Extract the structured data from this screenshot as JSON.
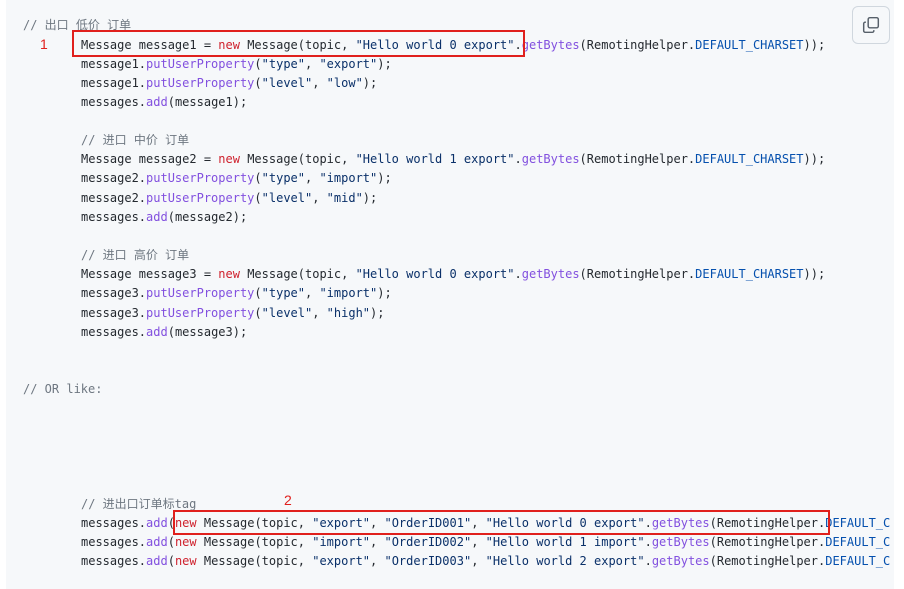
{
  "code_lines": [
    [
      {
        "t": "// 出口 低价 订单",
        "c": "c"
      }
    ],
    [
      {
        "t": "Message message1 = ",
        "c": "p"
      },
      {
        "t": "new",
        "c": "k"
      },
      {
        "t": " Message(topic, ",
        "c": "p"
      },
      {
        "t": "\"Hello world 0 export\"",
        "c": "s"
      },
      {
        "t": ".",
        "c": "p"
      },
      {
        "t": "getBytes",
        "c": "m"
      },
      {
        "t": "(RemotingHelper.",
        "c": "p"
      },
      {
        "t": "DEFAULT_CHARSET",
        "c": "n"
      },
      {
        "t": "));",
        "c": "p"
      }
    ],
    [
      {
        "t": "message1.",
        "c": "p"
      },
      {
        "t": "putUserProperty",
        "c": "m"
      },
      {
        "t": "(",
        "c": "p"
      },
      {
        "t": "\"type\"",
        "c": "s"
      },
      {
        "t": ", ",
        "c": "p"
      },
      {
        "t": "\"export\"",
        "c": "s"
      },
      {
        "t": ");",
        "c": "p"
      }
    ],
    [
      {
        "t": "message1.",
        "c": "p"
      },
      {
        "t": "putUserProperty",
        "c": "m"
      },
      {
        "t": "(",
        "c": "p"
      },
      {
        "t": "\"level\"",
        "c": "s"
      },
      {
        "t": ", ",
        "c": "p"
      },
      {
        "t": "\"low\"",
        "c": "s"
      },
      {
        "t": ");",
        "c": "p"
      }
    ],
    [
      {
        "t": "messages.",
        "c": "p"
      },
      {
        "t": "add",
        "c": "m"
      },
      {
        "t": "(message1);",
        "c": "p"
      }
    ],
    [
      {
        "t": "// 进口 中价 订单",
        "c": "c"
      }
    ],
    [
      {
        "t": "Message message2 = ",
        "c": "p"
      },
      {
        "t": "new",
        "c": "k"
      },
      {
        "t": " Message(topic, ",
        "c": "p"
      },
      {
        "t": "\"Hello world 1 export\"",
        "c": "s"
      },
      {
        "t": ".",
        "c": "p"
      },
      {
        "t": "getBytes",
        "c": "m"
      },
      {
        "t": "(RemotingHelper.",
        "c": "p"
      },
      {
        "t": "DEFAULT_CHARSET",
        "c": "n"
      },
      {
        "t": "));",
        "c": "p"
      }
    ],
    [
      {
        "t": "message2.",
        "c": "p"
      },
      {
        "t": "putUserProperty",
        "c": "m"
      },
      {
        "t": "(",
        "c": "p"
      },
      {
        "t": "\"type\"",
        "c": "s"
      },
      {
        "t": ", ",
        "c": "p"
      },
      {
        "t": "\"import\"",
        "c": "s"
      },
      {
        "t": ");",
        "c": "p"
      }
    ],
    [
      {
        "t": "message2.",
        "c": "p"
      },
      {
        "t": "putUserProperty",
        "c": "m"
      },
      {
        "t": "(",
        "c": "p"
      },
      {
        "t": "\"level\"",
        "c": "s"
      },
      {
        "t": ", ",
        "c": "p"
      },
      {
        "t": "\"mid\"",
        "c": "s"
      },
      {
        "t": ");",
        "c": "p"
      }
    ],
    [
      {
        "t": "messages.",
        "c": "p"
      },
      {
        "t": "add",
        "c": "m"
      },
      {
        "t": "(message2);",
        "c": "p"
      }
    ],
    [
      {
        "t": "// 进口 高价 订单",
        "c": "c"
      }
    ],
    [
      {
        "t": "Message message3 = ",
        "c": "p"
      },
      {
        "t": "new",
        "c": "k"
      },
      {
        "t": " Message(topic, ",
        "c": "p"
      },
      {
        "t": "\"Hello world 0 export\"",
        "c": "s"
      },
      {
        "t": ".",
        "c": "p"
      },
      {
        "t": "getBytes",
        "c": "m"
      },
      {
        "t": "(RemotingHelper.",
        "c": "p"
      },
      {
        "t": "DEFAULT_CHARSET",
        "c": "n"
      },
      {
        "t": "));",
        "c": "p"
      }
    ],
    [
      {
        "t": "message3.",
        "c": "p"
      },
      {
        "t": "putUserProperty",
        "c": "m"
      },
      {
        "t": "(",
        "c": "p"
      },
      {
        "t": "\"type\"",
        "c": "s"
      },
      {
        "t": ", ",
        "c": "p"
      },
      {
        "t": "\"import\"",
        "c": "s"
      },
      {
        "t": ");",
        "c": "p"
      }
    ],
    [
      {
        "t": "message3.",
        "c": "p"
      },
      {
        "t": "putUserProperty",
        "c": "m"
      },
      {
        "t": "(",
        "c": "p"
      },
      {
        "t": "\"level\"",
        "c": "s"
      },
      {
        "t": ", ",
        "c": "p"
      },
      {
        "t": "\"high\"",
        "c": "s"
      },
      {
        "t": ");",
        "c": "p"
      }
    ],
    [
      {
        "t": "messages.",
        "c": "p"
      },
      {
        "t": "add",
        "c": "m"
      },
      {
        "t": "(message3);",
        "c": "p"
      }
    ],
    [
      {
        "t": "// OR like:",
        "c": "c"
      }
    ],
    [
      {
        "t": "// 进出口订单标tag",
        "c": "c"
      }
    ],
    [
      {
        "t": "messages.",
        "c": "p"
      },
      {
        "t": "add",
        "c": "m"
      },
      {
        "t": "(",
        "c": "p"
      },
      {
        "t": "new",
        "c": "k"
      },
      {
        "t": " Message(topic, ",
        "c": "p"
      },
      {
        "t": "\"export\"",
        "c": "s"
      },
      {
        "t": ", ",
        "c": "p"
      },
      {
        "t": "\"OrderID001\"",
        "c": "s"
      },
      {
        "t": ", ",
        "c": "p"
      },
      {
        "t": "\"Hello world 0 export\"",
        "c": "s"
      },
      {
        "t": ".",
        "c": "p"
      },
      {
        "t": "getBytes",
        "c": "m"
      },
      {
        "t": "(RemotingHelper.",
        "c": "p"
      },
      {
        "t": "DEFAULT_C",
        "c": "n"
      }
    ],
    [
      {
        "t": "messages.",
        "c": "p"
      },
      {
        "t": "add",
        "c": "m"
      },
      {
        "t": "(",
        "c": "p"
      },
      {
        "t": "new",
        "c": "k"
      },
      {
        "t": " Message(topic, ",
        "c": "p"
      },
      {
        "t": "\"import\"",
        "c": "s"
      },
      {
        "t": ", ",
        "c": "p"
      },
      {
        "t": "\"OrderID002\"",
        "c": "s"
      },
      {
        "t": ", ",
        "c": "p"
      },
      {
        "t": "\"Hello world 1 import\"",
        "c": "s"
      },
      {
        "t": ".",
        "c": "p"
      },
      {
        "t": "getBytes",
        "c": "m"
      },
      {
        "t": "(RemotingHelper.",
        "c": "p"
      },
      {
        "t": "DEFAULT_C",
        "c": "n"
      }
    ],
    [
      {
        "t": "messages.",
        "c": "p"
      },
      {
        "t": "add",
        "c": "m"
      },
      {
        "t": "(",
        "c": "p"
      },
      {
        "t": "new",
        "c": "k"
      },
      {
        "t": " Message(topic, ",
        "c": "p"
      },
      {
        "t": "\"export\"",
        "c": "s"
      },
      {
        "t": ", ",
        "c": "p"
      },
      {
        "t": "\"OrderID003\"",
        "c": "s"
      },
      {
        "t": ", ",
        "c": "p"
      },
      {
        "t": "\"Hello world 2 export\"",
        "c": "s"
      },
      {
        "t": ".",
        "c": "p"
      },
      {
        "t": "getBytes",
        "c": "m"
      },
      {
        "t": "(RemotingHelper.",
        "c": "p"
      },
      {
        "t": "DEFAULT_C",
        "c": "n"
      }
    ]
  ],
  "annotations": {
    "label_1": "1",
    "label_2": "2",
    "color": "#e0201d"
  },
  "copy_button": {
    "icon": "copy-icon"
  },
  "colors": {
    "background": "#f6f8fa",
    "plain": "#24292f",
    "keyword": "#cf222e",
    "method": "#8250df",
    "comment": "#6e7781",
    "string": "#0a3069",
    "constant": "#0550ae"
  }
}
